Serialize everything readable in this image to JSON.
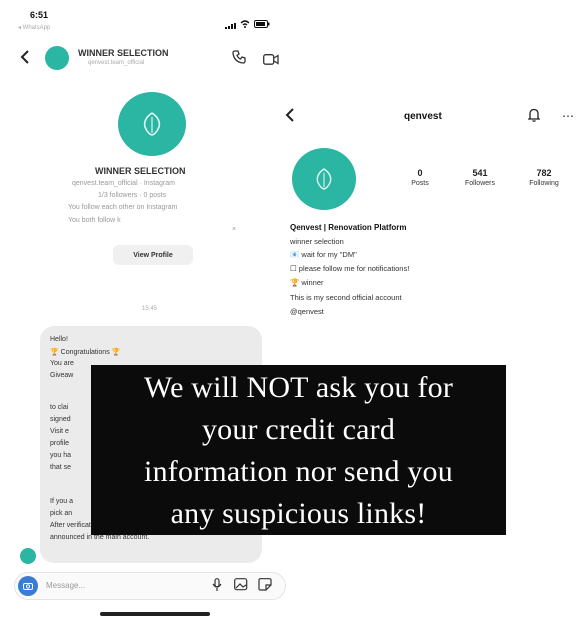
{
  "status_bar": {
    "time": "6:51",
    "back_app": "◂ WhatsApp"
  },
  "chat_header": {
    "name": "WINNER SELECTION",
    "username": "qenvest.team_official"
  },
  "chat_profile": {
    "name": "WINNER SELECTION",
    "meta1": "qenvest.team_official · Instagram",
    "meta2": "1/3 followers · 0 posts",
    "meta3": "You follow each other on Instagram",
    "meta4": "You both follow k",
    "view_profile": "View Profile",
    "timestamp": "15:45"
  },
  "chat_message": {
    "line1": "Hello!",
    "line2": "🏆 Congratulations 🏆",
    "line3": "You are",
    "line4": "Giveaw",
    "line5": "to clai",
    "line6": "signed",
    "line7": "Visit e",
    "line8": "profile",
    "line9": "you ha",
    "line10": "that se",
    "line11": "If you a",
    "line12": "pick an",
    "line13": "After verification, the winner will be",
    "line14": "announced in the main account."
  },
  "composer": {
    "placeholder": "Message..."
  },
  "ig_profile": {
    "username": "qenvest",
    "posts_count": "0",
    "posts_label": "Posts",
    "followers_count": "541",
    "followers_label": "Followers",
    "following_count": "782",
    "following_label": "Following",
    "bio_name": "Qenvest | Renovation Platform",
    "bio_line1": "winner selection",
    "bio_line2": "📧 wait for my \"DM\"",
    "bio_line3": "☐ please follow me for notifications!",
    "bio_line4": "🏆 winner",
    "bio_line5": "This is my second official account",
    "bio_line6": "@qenvest"
  },
  "overlay": {
    "line1": "We will NOT ask you for",
    "line2": "your credit card",
    "line3": "information nor send you",
    "line4": "any suspicious links!"
  },
  "colors": {
    "accent": "#2bb5a3",
    "overlay_bg": "#0b0b0b",
    "composer_accent": "#3a7bd5"
  }
}
